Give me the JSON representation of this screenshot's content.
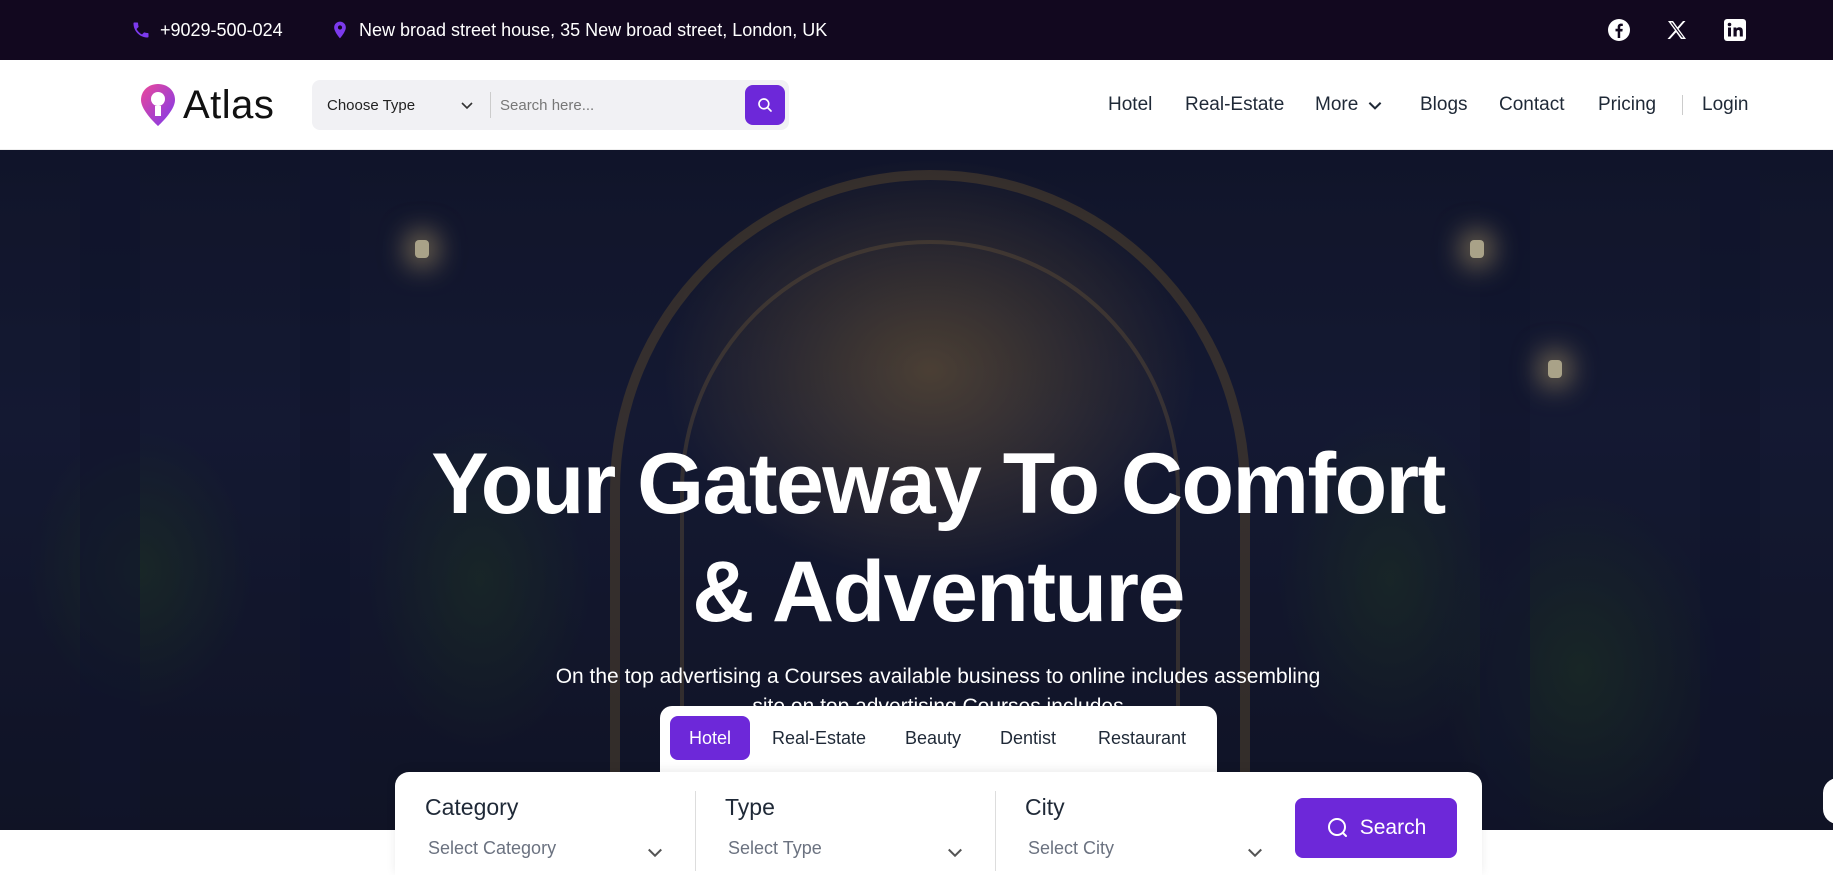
{
  "topbar": {
    "phone": "+9029-500-024",
    "address": "New broad street house, 35 New broad street, London, UK",
    "social": [
      "facebook-icon",
      "x-icon",
      "linkedin-icon"
    ]
  },
  "header": {
    "logo_text": "Atlas",
    "search": {
      "type_label": "Choose Type",
      "placeholder": "Search here..."
    },
    "nav": {
      "hotel": "Hotel",
      "real_estate": "Real-Estate",
      "more": "More",
      "blogs": "Blogs",
      "contact": "Contact",
      "pricing": "Pricing",
      "login": "Login"
    }
  },
  "hero": {
    "title_line1": "Your Gateway To Comfort",
    "title_line2": "& Adventure",
    "subtitle": "On the top advertising a Courses available business to online includes assembling site on top advertising Courses includes",
    "slides_total": 5,
    "active_slide": 1
  },
  "search_tabs": {
    "hotel": "Hotel",
    "real_estate": "Real-Estate",
    "beauty": "Beauty",
    "dentist": "Dentist",
    "restaurant": "Restaurant",
    "active": "Hotel"
  },
  "search_panel": {
    "category_label": "Category",
    "category_value": "Select Category",
    "type_label": "Type",
    "type_value": "Select Type",
    "city_label": "City",
    "city_value": "Select City",
    "button": "Search"
  },
  "colors": {
    "accent": "#6d28d9",
    "topbar_bg": "#12081f"
  }
}
